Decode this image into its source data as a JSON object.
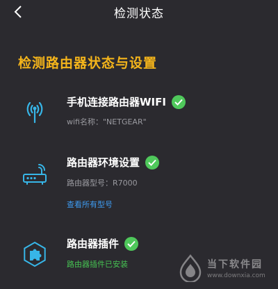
{
  "header": {
    "title": "检测状态"
  },
  "section": {
    "heading": "检测路由器状态与设置"
  },
  "items": [
    {
      "title": "手机连接路由器WIFI",
      "sub": "wifi名称：\"NETGEAR\"",
      "icon": "wifi-signal-icon",
      "status": "checked"
    },
    {
      "title": "路由器环境设置",
      "sub": "路由器型号：R7000",
      "link": "查看所有型号",
      "icon": "router-icon",
      "status": "checked"
    },
    {
      "title": "路由器插件",
      "status_text": "路由器插件已安装",
      "icon": "plugin-puzzle-icon",
      "status": "checked"
    }
  ],
  "watermark": {
    "text": "当下软件园",
    "url": "www.downxia.com"
  },
  "colors": {
    "background": "#2b2a2f",
    "heading": "#f5b51b",
    "check": "#4fc85b",
    "link": "#3e9bf0",
    "icon_accent": "#37b6e8"
  }
}
